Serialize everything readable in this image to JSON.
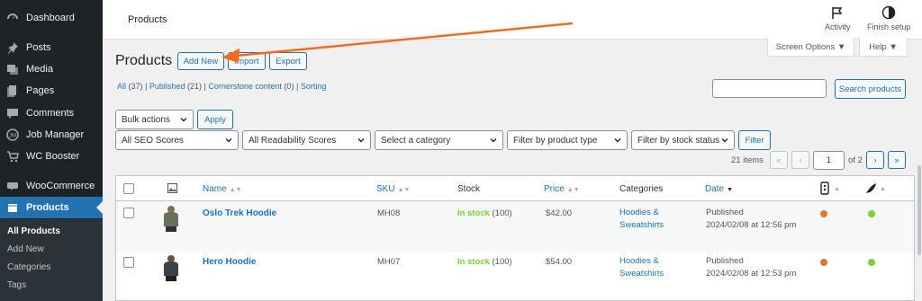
{
  "sidebar": {
    "items": [
      {
        "label": "Dashboard",
        "icon": "dashboard-icon"
      },
      {
        "label": "Posts",
        "icon": "pin-icon"
      },
      {
        "label": "Media",
        "icon": "media-icon"
      },
      {
        "label": "Pages",
        "icon": "pages-icon"
      },
      {
        "label": "Comments",
        "icon": "comments-icon"
      },
      {
        "label": "Job Manager",
        "icon": "job-manager-icon"
      },
      {
        "label": "WC Booster",
        "icon": "cart-icon"
      },
      {
        "label": "WooCommerce",
        "icon": "woocommerce-icon"
      },
      {
        "label": "Products",
        "icon": "products-icon"
      }
    ],
    "submenu": [
      "All Products",
      "Add New",
      "Categories",
      "Tags"
    ]
  },
  "topbar": {
    "title": "Products",
    "activity_label": "Activity",
    "finish_setup_label": "Finish setup"
  },
  "screen_options_label": "Screen Options ▼",
  "help_label": "Help ▼",
  "page": {
    "title": "Products",
    "add_new": "Add New",
    "import": "Import",
    "export": "Export"
  },
  "views": {
    "all": "All",
    "all_count": "(37)",
    "sep1": "|",
    "published": "Published",
    "published_count": "(21)",
    "sep2": "|",
    "cornerstone": "Cornerstone content",
    "cornerstone_count": "(0)",
    "sep3": "|",
    "sorting": "Sorting"
  },
  "search": {
    "button": "Search products",
    "value": ""
  },
  "bulk": {
    "selected": "Bulk actions",
    "apply": "Apply"
  },
  "filters": {
    "seo": "All SEO Scores",
    "readability": "All Readability Scores",
    "category": "Select a category",
    "product_type": "Filter by product type",
    "stock_status": "Filter by stock status",
    "filter_button": "Filter"
  },
  "pagination": {
    "items": "21 items",
    "first": "«",
    "prev": "‹",
    "current_page": "1",
    "of_pages": "of 2",
    "next": "›",
    "last": "»"
  },
  "table": {
    "columns": {
      "name": "Name",
      "sku": "SKU",
      "stock": "Stock",
      "price": "Price",
      "categories": "Categories",
      "date": "Date"
    },
    "rows": [
      {
        "name": "Oslo Trek Hoodie",
        "sku": "MH08",
        "stock_status": "In stock",
        "stock_qty": "(100)",
        "price": "$42.00",
        "category_line1": "Hoodies &",
        "category_line2": "Sweatshirts",
        "date_status": "Published",
        "date_value": "2024/02/08 at 12:56 pm",
        "seo_color": "#dd7a2c",
        "readability_color": "#7ad03a"
      },
      {
        "name": "Hero Hoodie",
        "sku": "MH07",
        "stock_status": "In stock",
        "stock_qty": "(100)",
        "price": "$54.00",
        "category_line1": "Hoodies &",
        "category_line2": "Sweatshirts",
        "date_status": "Published",
        "date_value": "2024/02/08 at 12:53 pm",
        "seo_color": "#dd7a2c",
        "readability_color": "#7ad03a"
      }
    ]
  },
  "colors": {
    "accent": "#2271b1",
    "sidebar_bg": "#1d2327",
    "in_stock": "#7ad03a",
    "annotation_arrow": "#f26b21"
  }
}
